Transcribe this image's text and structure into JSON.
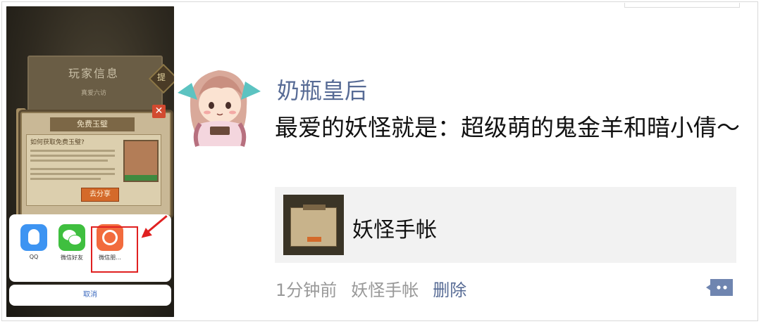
{
  "game": {
    "player_info_title": "玩家信息",
    "player_sub": "真爱六访",
    "pin_label": "提",
    "dialog_title": "免费玉璧",
    "dialog_heading": "如何获取免费玉璧?",
    "dialog_button": "去分享",
    "close_symbol": "✕"
  },
  "share_sheet": {
    "items": [
      {
        "label": "QQ",
        "icon": "qq-icon"
      },
      {
        "label": "微信好友",
        "icon": "wechat-icon"
      },
      {
        "label": "微信朋...",
        "icon": "moments-icon"
      }
    ],
    "cancel": "取消"
  },
  "post": {
    "username": "奶瓶皇后",
    "text": "最爱的妖怪就是：超级萌的鬼金羊和暗小倩～",
    "link_card": {
      "title": "妖怪手帐",
      "thumbnail_icon": "game-dialog-thumbnail"
    },
    "time": "1分钟前",
    "source": "妖怪手帐",
    "delete": "删除",
    "comment_icon": "comment-bubble-icon"
  },
  "colors": {
    "username": "#576b95",
    "highlight": "#e02020",
    "card_bg": "#f2f2f2"
  }
}
